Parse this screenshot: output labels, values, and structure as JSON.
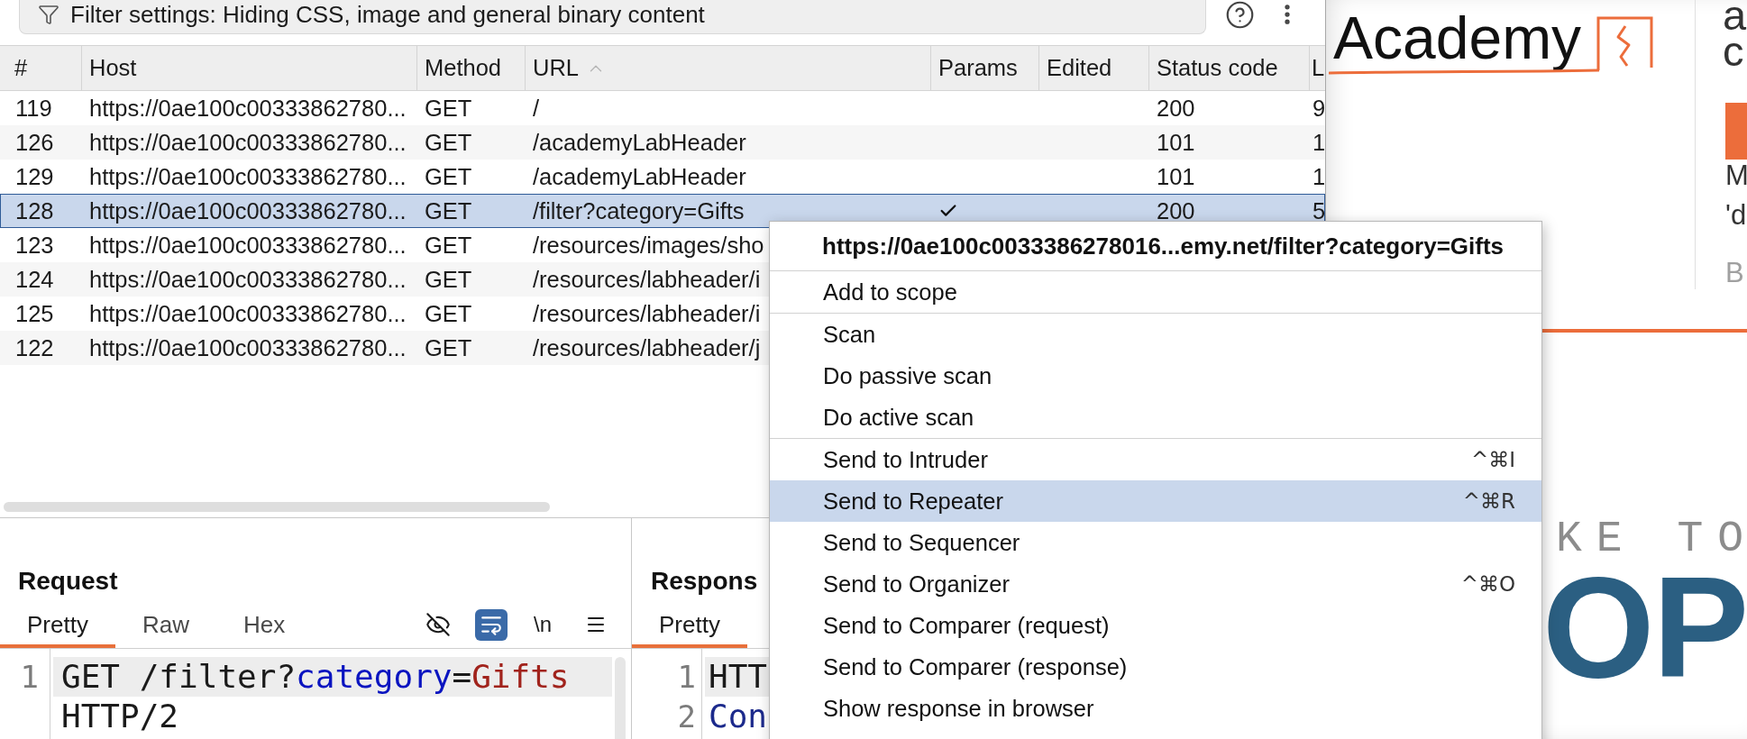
{
  "filter_bar": {
    "text": "Filter settings: Hiding CSS, image and general binary content"
  },
  "table": {
    "columns": [
      {
        "label": "#",
        "sorted": false
      },
      {
        "label": "Host",
        "sorted": false
      },
      {
        "label": "Method",
        "sorted": false
      },
      {
        "label": "URL",
        "sorted": true
      },
      {
        "label": "Params",
        "sorted": false
      },
      {
        "label": "Edited",
        "sorted": false
      },
      {
        "label": "Status code",
        "sorted": false
      },
      {
        "label": "L",
        "sorted": false
      }
    ],
    "rows": [
      {
        "number": "119",
        "host": "https://0ae100c00333862780...",
        "method": "GET",
        "url": "/",
        "params": false,
        "status_code": "200",
        "column_8": "9",
        "selected": false
      },
      {
        "number": "126",
        "host": "https://0ae100c00333862780...",
        "method": "GET",
        "url": "/academyLabHeader",
        "params": false,
        "status_code": "101",
        "column_8": "1",
        "selected": false
      },
      {
        "number": "129",
        "host": "https://0ae100c00333862780...",
        "method": "GET",
        "url": "/academyLabHeader",
        "params": false,
        "status_code": "101",
        "column_8": "1",
        "selected": false
      },
      {
        "number": "128",
        "host": "https://0ae100c00333862780...",
        "method": "GET",
        "url": "/filter?category=Gifts",
        "params": true,
        "status_code": "200",
        "column_8": "5",
        "selected": true
      },
      {
        "number": "123",
        "host": "https://0ae100c00333862780...",
        "method": "GET",
        "url": "/resources/images/sho",
        "selected": false
      },
      {
        "number": "124",
        "host": "https://0ae100c00333862780...",
        "method": "GET",
        "url": "/resources/labheader/i",
        "selected": false
      },
      {
        "number": "125",
        "host": "https://0ae100c00333862780...",
        "method": "GET",
        "url": "/resources/labheader/i",
        "selected": false
      },
      {
        "number": "122",
        "host": "https://0ae100c00333862780...",
        "method": "GET",
        "url": "/resources/labheader/j",
        "selected": false
      }
    ]
  },
  "request": {
    "title": "Request",
    "tabs": [
      {
        "label": "Pretty",
        "selected": true
      },
      {
        "label": "Raw",
        "selected": false
      },
      {
        "label": "Hex",
        "selected": false
      }
    ],
    "toolbar": [
      {
        "kind": "hide"
      },
      {
        "kind": "wrap",
        "on": true
      },
      {
        "kind": "newline",
        "label": "\\n"
      },
      {
        "kind": "menu"
      }
    ],
    "lines": [
      {
        "number": "1",
        "highlighted": true,
        "tokens": [
          {
            "text": "GET /filter?",
            "kind": "plain"
          },
          {
            "text": "category",
            "kind": "param_name"
          },
          {
            "text": "=",
            "kind": "plain"
          },
          {
            "text": "Gifts",
            "kind": "param_value"
          }
        ]
      },
      {
        "highlighted": false,
        "tokens": [
          {
            "text": "HTTP/2",
            "kind": "plain"
          }
        ]
      }
    ]
  },
  "response": {
    "title": "Respons",
    "tabs": [
      {
        "label": "Pretty",
        "selected": true
      }
    ],
    "lines": [
      {
        "number": "1",
        "highlighted": true,
        "tokens": [
          {
            "text": "HTT",
            "kind": "plain"
          }
        ]
      },
      {
        "number": "2",
        "highlighted": false,
        "tokens": [
          {
            "text": "Con",
            "kind": "header_name"
          }
        ]
      }
    ]
  },
  "context_menu": {
    "title": "https://0ae100c0033386278016...emy.net/filter?category=Gifts",
    "items": [
      {
        "kind": "separator"
      },
      {
        "kind": "item",
        "label": "Add to scope",
        "selected": false
      },
      {
        "kind": "separator"
      },
      {
        "kind": "item",
        "label": "Scan",
        "selected": false
      },
      {
        "kind": "item",
        "label": "Do passive scan",
        "selected": false
      },
      {
        "kind": "item",
        "label": "Do active scan",
        "selected": false
      },
      {
        "kind": "separator"
      },
      {
        "kind": "item",
        "label": "Send to Intruder",
        "shortcut": "^⌘I",
        "selected": false
      },
      {
        "kind": "item",
        "label": "Send to Repeater",
        "shortcut": "^⌘R",
        "selected": true
      },
      {
        "kind": "item",
        "label": "Send to Sequencer",
        "selected": false
      },
      {
        "kind": "item",
        "label": "Send to Organizer",
        "shortcut": "^⌘O",
        "selected": false
      },
      {
        "kind": "item",
        "label": "Send to Comparer (request)",
        "selected": false
      },
      {
        "kind": "item",
        "label": "Send to Comparer (response)",
        "selected": false
      },
      {
        "kind": "item",
        "label": "Show response in browser",
        "selected": false
      }
    ]
  },
  "browser_page": {
    "logo_text": "Academy",
    "heading_lines": [
      "a",
      "c"
    ],
    "paragraph_lines": [
      "M",
      "'d"
    ],
    "muted_text": "B",
    "banner_text": "KE TO",
    "hero_text": "OP"
  }
}
